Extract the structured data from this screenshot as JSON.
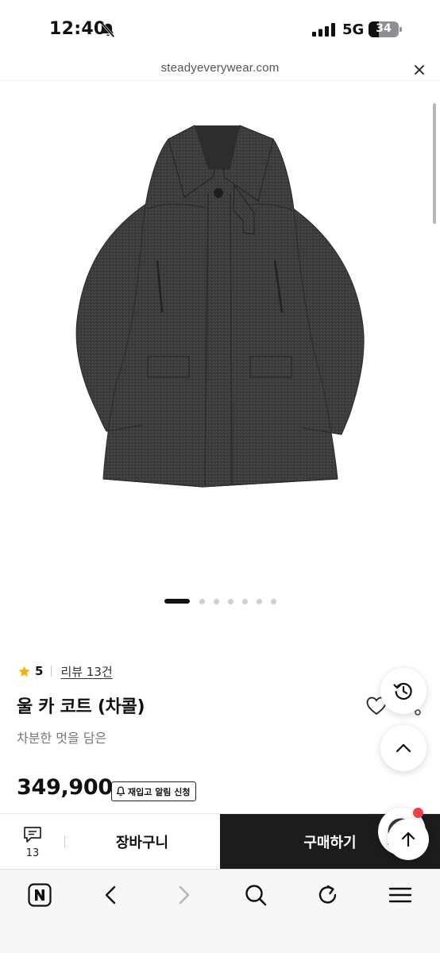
{
  "status_bar": {
    "time": "12:40",
    "network": "5G",
    "battery": 34
  },
  "browser": {
    "url": "steadyeverywear.com"
  },
  "carousel": {
    "total_slides": 7,
    "active_index": 0
  },
  "product": {
    "rating": "5",
    "review_link": "리뷰 13건",
    "title": "울 카 코트 (차콜)",
    "subtitle": "차분한 멋을 담은",
    "price": "349,900",
    "restock_label": "재입고 알림 신청"
  },
  "bottom_bar": {
    "review_count": "13",
    "cart_label": "장바구니",
    "buy_label": "구매하기"
  },
  "colors": {
    "coat": "#3b3b3b",
    "buy_button": "#1c1c1c",
    "star": "#f5b301",
    "notification_dot": "#ef3f4c"
  },
  "icons": {
    "status": [
      "bell-slash-icon",
      "signal-icon"
    ],
    "actions": [
      "heart-icon",
      "share-icon",
      "history-icon",
      "chevron-up-icon",
      "arrow-up-icon"
    ],
    "toolbar": [
      "naver-icon",
      "back-icon",
      "forward-icon",
      "search-icon",
      "refresh-icon",
      "menu-icon"
    ]
  }
}
